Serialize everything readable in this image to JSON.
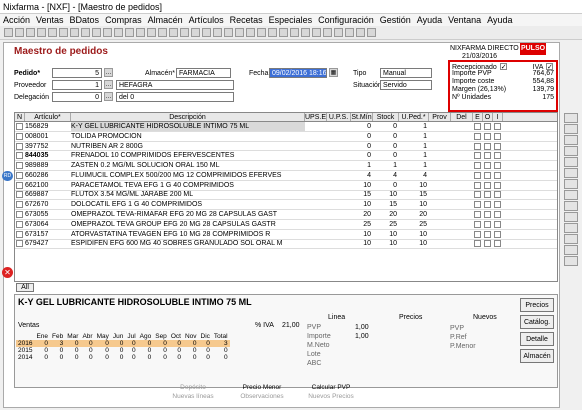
{
  "window_title": "Nixfarma - [NXF] - [Maestro de pedidos]",
  "menu": [
    "Acción",
    "Ventas",
    "BDatos",
    "Compras",
    "Almacén",
    "Artículos",
    "Recetas",
    "Especiales",
    "Configuración",
    "Gestión",
    "Ayuda",
    "Ventana",
    "Ayuda"
  ],
  "form_title": "Maestro de pedidos",
  "pharmacy": "NIXFARMA DIRECTO",
  "pharmacy_date": "21/03/2016",
  "pulso": "PULSO",
  "pedido": {
    "label": "Pedido*",
    "value": "5"
  },
  "proveedor": {
    "label": "Proveedor",
    "value": "1",
    "name": "HEFAGRA"
  },
  "delegacion": {
    "label": "Delegación",
    "value": "0",
    "name": "del 0"
  },
  "almacen": {
    "label": "Almacén*",
    "value": "FARMACIA"
  },
  "fecha": {
    "label": "Fecha",
    "value": "09/02/2016 18:16"
  },
  "tipo": {
    "label": "Tipo",
    "value": "Manual"
  },
  "situacion": {
    "label": "Situación",
    "value": "Servido"
  },
  "info": {
    "recepcionado": "Recepcionado",
    "iva": "IVA",
    "impvp_label": "Importe PVP",
    "impvp": "764,67",
    "imcoste_label": "Importe coste",
    "imcoste": "554,88",
    "margen_label": "Margen",
    "margen_pct": "26,13%",
    "margen": "139,79",
    "unidades_label": "Nº Unidades",
    "unidades": "175"
  },
  "columns": [
    "N",
    "Artículo*",
    "Descripción",
    "UPS.E",
    "U.P.S.",
    "St.Mín",
    "Stock",
    "U.Ped.*",
    "Prov",
    "Del",
    "E",
    "O",
    "I"
  ],
  "rows": [
    {
      "art": "156829",
      "desc": "K-Y GEL LUBRICANTE HIDROSOLUBLE INTIMO 75 ML",
      "min": "0",
      "stock": "0",
      "ped": "1",
      "bold": false
    },
    {
      "art": "008001",
      "desc": "TOLIDA PROMOCION",
      "min": "0",
      "stock": "0",
      "ped": "1",
      "bold": false
    },
    {
      "art": "397752",
      "desc": "NUTRIBEN AR 2 800G",
      "min": "0",
      "stock": "0",
      "ped": "1",
      "bold": false
    },
    {
      "art": "844035",
      "desc": "FRENADOL 10 COMPRIMIDOS EFERVESCENTES",
      "min": "0",
      "stock": "0",
      "ped": "1",
      "bold": true
    },
    {
      "art": "989889",
      "desc": "ZASTEN 0.2 MG/ML SOLUCION ORAL 150 ML",
      "min": "1",
      "stock": "1",
      "ped": "1",
      "bold": false
    },
    {
      "art": "660286",
      "desc": "FLUIMUCIL COMPLEX 500/200 MG 12 COMPRIMIDOS EFERVES",
      "min": "4",
      "stock": "4",
      "ped": "4",
      "bold": false
    },
    {
      "art": "662100",
      "desc": "PARACETAMOL TEVA EFG 1 G 40 COMPRIMIDOS",
      "min": "10",
      "stock": "0",
      "ped": "10",
      "bold": false
    },
    {
      "art": "669887",
      "desc": "FLUTOX 3.54 MG/ML JARABE 200 ML",
      "min": "15",
      "stock": "10",
      "ped": "15",
      "bold": false
    },
    {
      "art": "672670",
      "desc": "DOLOCATIL EFG 1 G 40 COMPRIMIDOS",
      "min": "10",
      "stock": "15",
      "ped": "10",
      "bold": false
    },
    {
      "art": "673055",
      "desc": "OMEPRAZOL TEVA-RIMAFAR EFG 20 MG 28 CAPSULAS GAST",
      "min": "20",
      "stock": "20",
      "ped": "20",
      "bold": false
    },
    {
      "art": "673064",
      "desc": "OMEPRAZOL TEVA GROUP EFG 20 MG 28 CAPSULAS GASTR",
      "min": "25",
      "stock": "25",
      "ped": "25",
      "bold": false
    },
    {
      "art": "673157",
      "desc": "ATORVASTATINA TEVAGEN EFG 10 MG 28 COMPRIMIDOS R",
      "min": "10",
      "stock": "10",
      "ped": "10",
      "bold": false
    },
    {
      "art": "679427",
      "desc": "ESPIDIFEN EFG 600 MG 40 SOBRES GRANULADO SOL ORAL M",
      "min": "10",
      "stock": "10",
      "ped": "10",
      "bold": false
    }
  ],
  "all_btn": "All",
  "detail_title": "K-Y GEL LUBRICANTE HIDROSOLUBLE INTIMO 75 ML",
  "ventas": {
    "label": "Ventas",
    "iva_label": "% IVA",
    "iva": "21,00",
    "months": [
      "Ene",
      "Feb",
      "Mar",
      "Abr",
      "May",
      "Jun",
      "Jul",
      "Ago",
      "Sep",
      "Oct",
      "Nov",
      "Dic",
      "Total"
    ],
    "years": [
      {
        "y": "2016",
        "vals": [
          "0",
          "3",
          "0",
          "0",
          "0",
          "0",
          "0",
          "0",
          "0",
          "0",
          "0",
          "0",
          "3"
        ]
      },
      {
        "y": "2015",
        "vals": [
          "0",
          "0",
          "0",
          "0",
          "0",
          "0",
          "0",
          "0",
          "0",
          "0",
          "0",
          "0",
          "0"
        ]
      },
      {
        "y": "2014",
        "vals": [
          "0",
          "0",
          "0",
          "0",
          "0",
          "0",
          "0",
          "0",
          "0",
          "0",
          "0",
          "0",
          "0"
        ]
      }
    ]
  },
  "linea": {
    "label": "Linea",
    "pvp": "1,00",
    "importe": "1,00",
    "rows": [
      "PVP",
      "Importe",
      "M.Neto",
      "Lote",
      "ABC"
    ]
  },
  "precios": {
    "label": "Precios"
  },
  "nuevos": {
    "label": "Nuevos",
    "rows": [
      "PVP",
      "P.Ref",
      "P.Menor"
    ]
  },
  "side_buttons": [
    "Precios",
    "Catálog.",
    "Detalle",
    "Almacén"
  ],
  "bottom_buttons": [
    {
      "label": "Depósito",
      "en": false
    },
    {
      "label": "Precio Menor",
      "en": true
    },
    {
      "label": "Calcular PVP",
      "en": true
    },
    {
      "label": "Nuevas líneas",
      "en": false
    },
    {
      "label": "Observaciones",
      "en": false
    },
    {
      "label": "Nuevos Precios",
      "en": false
    }
  ]
}
